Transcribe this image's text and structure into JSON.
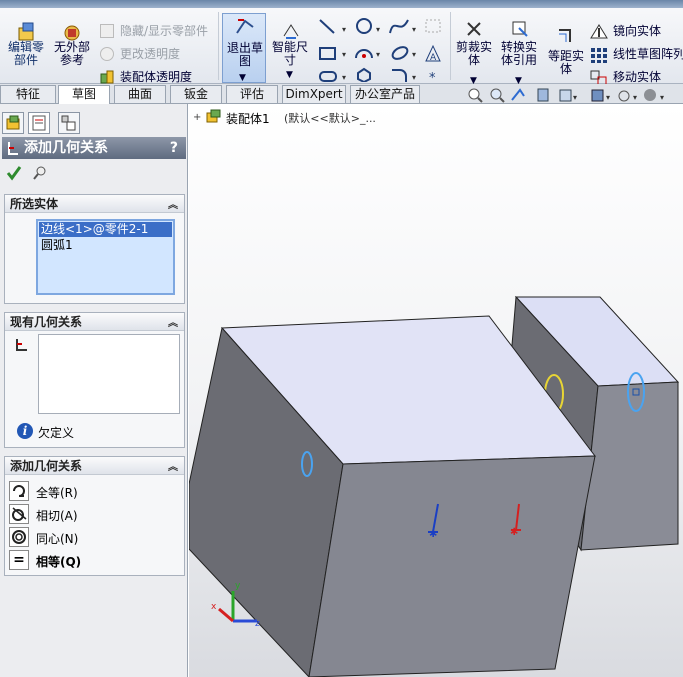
{
  "ribbon": {
    "edit_part": "编辑零部件",
    "no_external_refs": "无外部参考",
    "hide_show_parts": "隐藏/显示零部件",
    "change_transparency": "更改透明度",
    "assembly_transparency": "装配体透明度",
    "exit_sketch": "退出草图",
    "smart_dimension": "智能尺寸",
    "trim_entities": "剪裁实体",
    "convert_entities": "转换实体引用",
    "offset_entities": "等距实体",
    "mirror_entities": "镜向实体",
    "linear_pattern": "线性草图阵列",
    "move_entities": "移动实体"
  },
  "tabs": [
    "特征",
    "草图",
    "曲面",
    "钣金",
    "评估",
    "DimXpert",
    "办公室产品"
  ],
  "tree": {
    "item": "装配体1",
    "config": "(默认<<默认>_..."
  },
  "panel": {
    "title": "添加几何关系",
    "help": "?",
    "selected_header": "所选实体",
    "selected_items": [
      "边线<1>@零件2-1",
      "圆弧1"
    ],
    "existing_header": "现有几何关系",
    "status": "欠定义",
    "add_header": "添加几何关系",
    "relations": [
      "全等(R)",
      "相切(A)",
      "同心(N)",
      "相等(Q)"
    ]
  },
  "colors": {
    "accent": "#2f66c6",
    "selection": "#d2e6ff"
  }
}
